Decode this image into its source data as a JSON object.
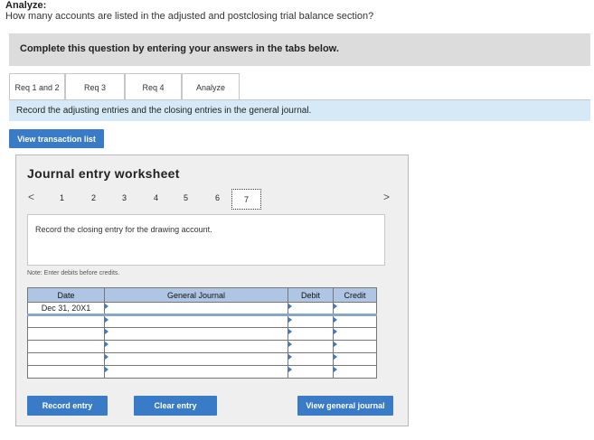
{
  "question": {
    "label": "Analyze:",
    "text": "How many accounts are listed in the adjusted and postclosing trial balance section?"
  },
  "instructions": "Complete this question by entering your answers in the tabs below.",
  "tabs": [
    {
      "label": "Req 1 and 2"
    },
    {
      "label": "Req 3"
    },
    {
      "label": "Req 4"
    },
    {
      "label": "Analyze"
    }
  ],
  "record_text": "Record the adjusting entries and the closing entries in the general journal.",
  "view_transaction_label": "View transaction list",
  "worksheet": {
    "title": "Journal entry worksheet",
    "pages": [
      "1",
      "2",
      "3",
      "4",
      "5",
      "6",
      "7"
    ],
    "current_page": "7",
    "prev_label": "<",
    "next_label": ">",
    "entry_prompt": "Record the closing entry for the drawing account.",
    "note": "Note: Enter debits before credits."
  },
  "table": {
    "headers": {
      "date": "Date",
      "general_journal": "General Journal",
      "debit": "Debit",
      "credit": "Credit"
    },
    "rows": [
      {
        "date": "Dec 31, 20X1"
      },
      {
        "date": ""
      },
      {
        "date": ""
      },
      {
        "date": ""
      },
      {
        "date": ""
      },
      {
        "date": ""
      }
    ]
  },
  "buttons": {
    "record_entry": "Record entry",
    "clear_entry": "Clear entry",
    "view_general_journal": "View general journal"
  },
  "colors": {
    "accent": "#3a7bc8",
    "header_fill": "#aec6e4",
    "record_bar": "#d6e9f6"
  }
}
